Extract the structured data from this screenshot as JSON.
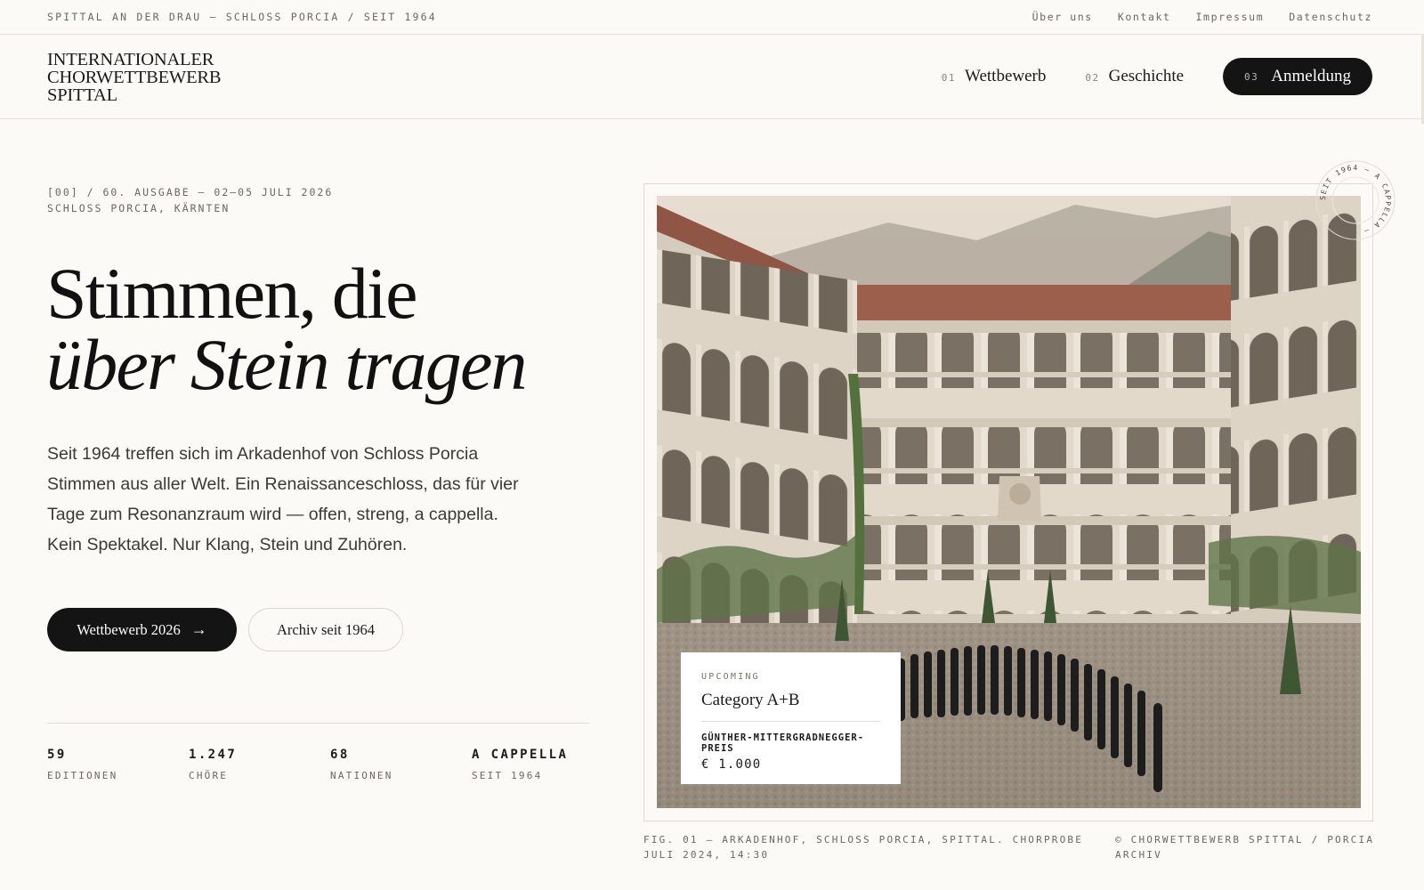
{
  "utility": {
    "tagline": "SPITTAL AN DER DRAU — SCHLOSS PORCIA / SEIT 1964",
    "links": [
      "Über uns",
      "Kontakt",
      "Impressum",
      "Datenschutz"
    ]
  },
  "logo": {
    "lines": [
      "INTERNATIONALER",
      "CHORWETTBEWERB",
      "SPITTAL"
    ]
  },
  "nav": {
    "items": [
      {
        "num": "01",
        "label": "Wettbewerb"
      },
      {
        "num": "02",
        "label": "Geschichte"
      }
    ],
    "cta": {
      "num": "03",
      "label": "Anmeldung"
    }
  },
  "hero": {
    "meta_line1": "[00] / 60. AUSGABE — 02–05 JULI 2026",
    "meta_line2": "SCHLOSS PORCIA, KÄRNTEN",
    "headline_line1": "Stimmen, die",
    "headline_line2": "über Stein tragen",
    "lead": "Seit 1964 treffen sich im Arkadenhof von Schloss Porcia Stimmen aus aller Welt. Ein Renaissanceschloss, das für vier Tage zum Resonanzraum wird — offen, streng, a cappella. Kein Spektakel. Nur Klang, Stein und Zuhören.",
    "primary_button": "Wettbewerb 2026",
    "primary_button_icon": "arrow-right-icon",
    "secondary_button": "Archiv seit 1964"
  },
  "stats": [
    {
      "value": "59",
      "label": "EDITIONEN"
    },
    {
      "value": "1.247",
      "label": "CHÖRE"
    },
    {
      "value": "68",
      "label": "NATIONEN"
    },
    {
      "value": "A CAPPELLA",
      "label": "SEIT 1964"
    }
  ],
  "seal": {
    "text": "SEIT 1964 — A CAPPELLA —"
  },
  "card": {
    "kicker": "UPCOMING",
    "title": "Category A+B",
    "prize": "GÜNTHER-MITTERGRADNEGGER-PREIS",
    "amount": "€ 1.000"
  },
  "caption": {
    "left": "FIG. 01 — ARKADENHOF, SCHLOSS PORCIA, SPITTAL. CHORPROBE JULI 2024, 14:30",
    "right": "© CHORWETTBEWERB SPITTAL / PORCIA ARCHIV"
  },
  "colors": {
    "background": "#fcfaf6",
    "ink": "#141414",
    "muted": "#6b6862",
    "rule": "#e2ded6"
  }
}
